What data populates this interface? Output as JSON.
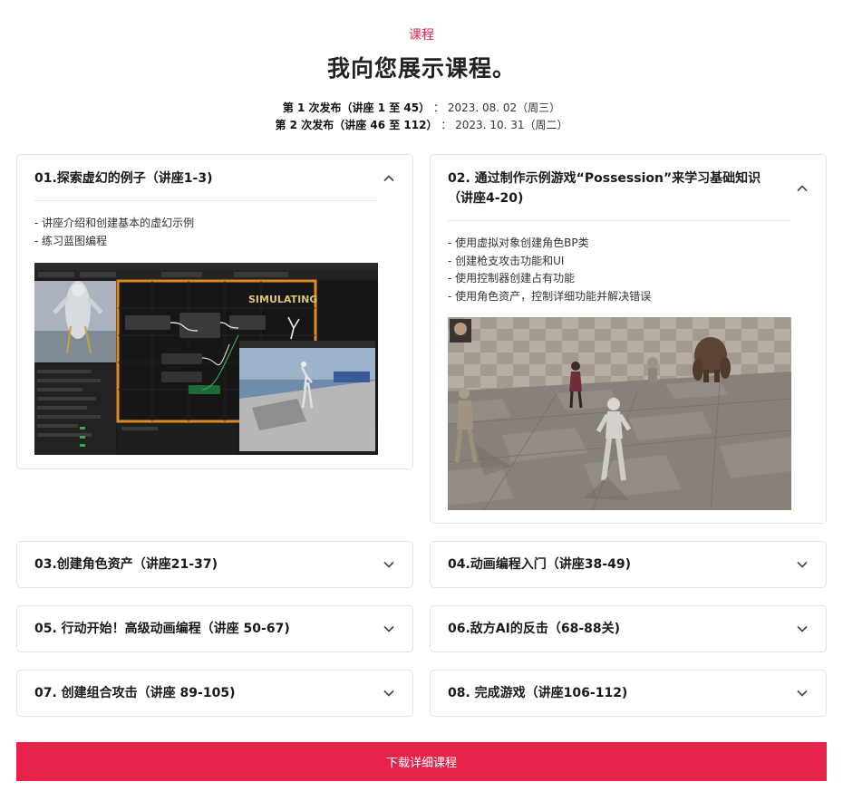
{
  "header": {
    "eyebrow": "课程",
    "title": "我向您展示课程。",
    "releases": [
      {
        "label": "第 1 次发布（讲座 1 至 45）",
        "sep": "：",
        "date": "2023. 08. 02（周三）"
      },
      {
        "label": "第 2 次发布（讲座 46 至 112）",
        "sep": "：",
        "date": "2023. 10. 31（周二）"
      }
    ]
  },
  "modules": [
    {
      "title": "01.探索虚幻的例子（讲座1-3)",
      "expanded": true,
      "icon": "chevron-up-icon",
      "bullets": [
        "- 讲座介绍和创建基本的虚幻示例",
        "- 练习蓝图编程"
      ],
      "image_label": "SIMULATING"
    },
    {
      "title": "02. 通过制作示例游戏“Possession”来学习基础知识（讲座4-20)",
      "expanded": true,
      "icon": "chevron-up-icon",
      "bullets": [
        "- 使用虚拟对象创建角色BP类",
        "- 创建枪支攻击功能和UI",
        "- 使用控制器创建占有功能",
        "- 使用角色资产，控制详细功能并解决错误"
      ]
    },
    {
      "title": "03.创建角色资产（讲座21-37)",
      "expanded": false,
      "icon": "chevron-down-icon"
    },
    {
      "title": "04.动画编程入门（讲座38-49)",
      "expanded": false,
      "icon": "chevron-down-icon"
    },
    {
      "title": "05. 行动开始！高级动画编程（讲座 50-67)",
      "expanded": false,
      "icon": "chevron-down-icon"
    },
    {
      "title": "06.敌方AI的反击（68-88关)",
      "expanded": false,
      "icon": "chevron-down-icon"
    },
    {
      "title": "07. 创建组合攻击（讲座 89-105)",
      "expanded": false,
      "icon": "chevron-down-icon"
    },
    {
      "title": "08. 完成游戏（讲座106-112)",
      "expanded": false,
      "icon": "chevron-down-icon"
    }
  ],
  "cta": {
    "label": "下载详细课程"
  },
  "colors": {
    "accent": "#e8234a",
    "eyebrow": "#e6264e",
    "border": "#e4e4e4"
  }
}
